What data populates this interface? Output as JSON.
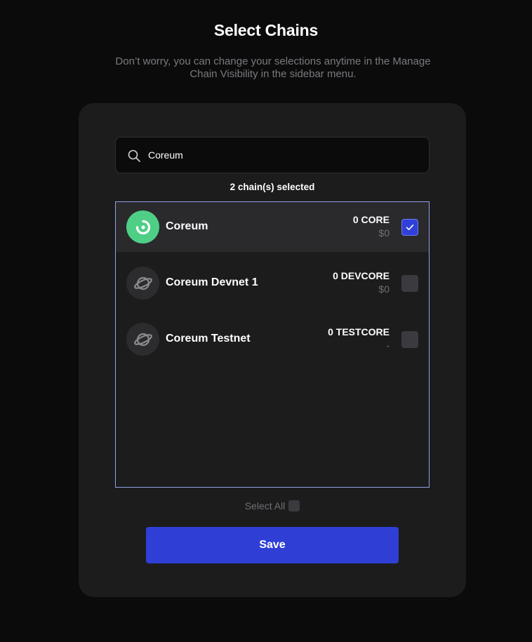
{
  "header": {
    "title": "Select Chains",
    "subtitle": "Don’t worry, you can change your selections anytime in the Manage Chain Visibility in the sidebar menu."
  },
  "search": {
    "value": "Coreum",
    "icon": "search-icon"
  },
  "selection": {
    "count_text": "2 chain(s) selected"
  },
  "chains": [
    {
      "name": "Coreum",
      "balance": "0 CORE",
      "value": "$0",
      "checked": true,
      "icon": "coreum-logo-icon",
      "logo_color": "#4fcf86"
    },
    {
      "name": "Coreum Devnet 1",
      "balance": "0 DEVCORE",
      "value": "$0",
      "checked": false,
      "icon": "planet-icon"
    },
    {
      "name": "Coreum Testnet",
      "balance": "0 TESTCORE",
      "value": "-",
      "checked": false,
      "icon": "planet-icon"
    }
  ],
  "footer": {
    "select_all_label": "Select All",
    "save_label": "Save"
  },
  "colors": {
    "accent": "#2f3fd6",
    "list_border": "#8fa3e6"
  }
}
